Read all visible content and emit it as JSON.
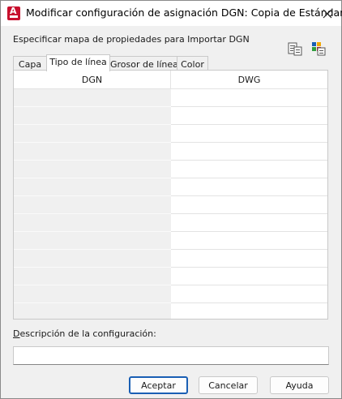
{
  "window": {
    "title": "Modificar configuración de asignación DGN: Copia de Estándar"
  },
  "section": {
    "label": "Especificar mapa de propiedades para Importar DGN"
  },
  "toolbar": {
    "icons": [
      "import-mapping-icon",
      "export-mapping-icon"
    ]
  },
  "tabs": [
    {
      "label": "Capa",
      "active": false
    },
    {
      "label": "Tipo de línea",
      "active": true
    },
    {
      "label": "Grosor de línea",
      "active": false
    },
    {
      "label": "Color",
      "active": false
    }
  ],
  "grid": {
    "columns": [
      "DGN",
      "DWG"
    ],
    "row_count": 13
  },
  "description": {
    "label_first": "D",
    "label_rest": "escripción de la configuración:",
    "value": ""
  },
  "buttons": {
    "accept": "Aceptar",
    "cancel": "Cancelar",
    "help": "Ayuda"
  },
  "colors": {
    "accent": "#1a5fb4",
    "app_icon": "#c8102e"
  }
}
